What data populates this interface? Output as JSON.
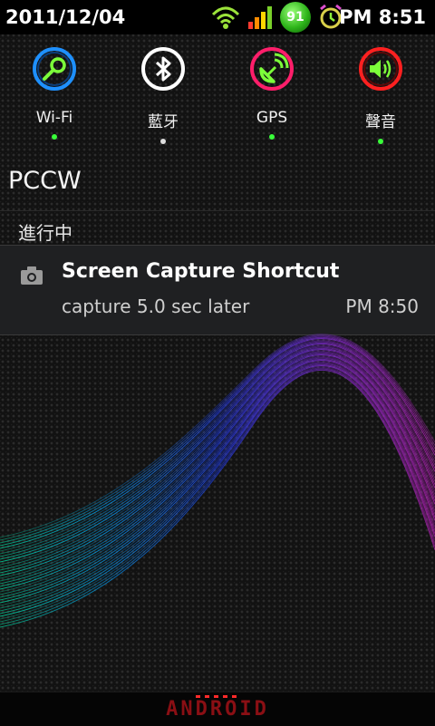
{
  "status_bar": {
    "date": "2011/12/04",
    "time": "PM 8:51",
    "battery_level": "91",
    "icons": [
      "wifi-signal-icon",
      "cell-signal-icon",
      "battery-icon",
      "alarm-clock-icon"
    ]
  },
  "toggles": [
    {
      "label": "Wi-Fi",
      "icon": "wifi-icon",
      "color": "#1e90ff",
      "indicator": "#39ff3a"
    },
    {
      "label": "藍牙",
      "icon": "bluetooth-icon",
      "color": "#ffffff",
      "indicator": "#dddddd"
    },
    {
      "label": "GPS",
      "icon": "gps-icon",
      "color": "#ff1e6a",
      "indicator": "#39ff3a"
    },
    {
      "label": "聲音",
      "icon": "sound-icon",
      "color": "#ff2020",
      "indicator": "#39ff3a"
    }
  ],
  "carrier": "PCCW",
  "ongoing_label": "進行中",
  "notification": {
    "icon": "camera-icon",
    "title": "Screen Capture Shortcut",
    "text": "capture 5.0 sec later",
    "time": "PM 8:50"
  },
  "footer": {
    "brand": "ANDROID",
    "brand_color": "#8a0f14"
  }
}
